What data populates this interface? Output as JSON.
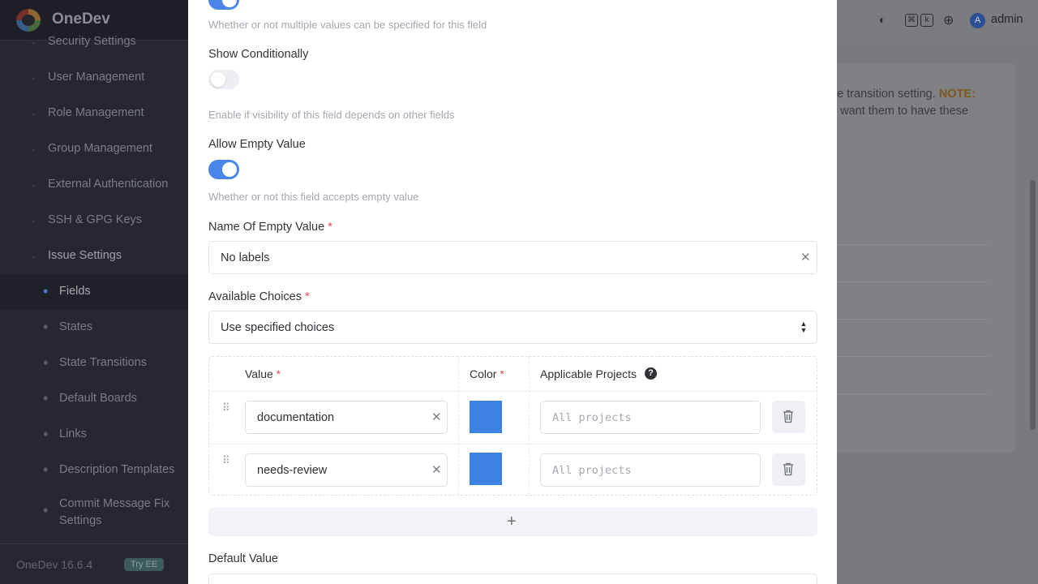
{
  "brand": {
    "name": "OneDev",
    "version": "OneDev 16.6.4",
    "try_ee": "Try EE"
  },
  "sidebar": {
    "items": [
      {
        "label": "Security Settings",
        "level": "top"
      },
      {
        "label": "User Management",
        "level": "top"
      },
      {
        "label": "Role Management",
        "level": "top"
      },
      {
        "label": "Group Management",
        "level": "top"
      },
      {
        "label": "External Authentication",
        "level": "top"
      },
      {
        "label": "SSH & GPG Keys",
        "level": "top"
      },
      {
        "label": "Issue Settings",
        "level": "top"
      },
      {
        "label": "Fields",
        "level": "sub",
        "active": true
      },
      {
        "label": "States",
        "level": "sub"
      },
      {
        "label": "State Transitions",
        "level": "sub"
      },
      {
        "label": "Default Boards",
        "level": "sub"
      },
      {
        "label": "Links",
        "level": "sub"
      },
      {
        "label": "Description Templates",
        "level": "sub"
      },
      {
        "label": "Commit Message Fix Settings",
        "level": "sub"
      }
    ]
  },
  "topbar": {
    "kbd_cmd": "⌘",
    "kbd_k": "k",
    "avatar_letter": "A",
    "user": "admin"
  },
  "background": {
    "note_prefix": "ue transition setting. ",
    "note_bold": "NOTE:",
    "note_rest": "u want them to have these"
  },
  "form": {
    "multiple_help": "Whether or not multiple values can be specified for this field",
    "multiple_on": true,
    "show_conditionally_label": "Show Conditionally",
    "show_conditionally_on": false,
    "show_conditionally_help": "Enable if visibility of this field depends on other fields",
    "allow_empty_label": "Allow Empty Value",
    "allow_empty_on": true,
    "allow_empty_help": "Whether or not this field accepts empty value",
    "empty_name_label": "Name Of Empty Value",
    "empty_name_value": "No labels",
    "available_choices_label": "Available Choices",
    "available_choices_value": "Use specified choices",
    "required_mark": "*",
    "default_value_label": "Default Value"
  },
  "choices": {
    "headers": {
      "value": "Value",
      "color": "Color",
      "projects": "Applicable Projects"
    },
    "rows": [
      {
        "value": "documentation",
        "color": "#3f82e6",
        "projects_placeholder": "All projects"
      },
      {
        "value": "needs-review",
        "color": "#3f82e6",
        "projects_placeholder": "All projects"
      }
    ],
    "add_label": "+"
  },
  "icons": {
    "theme": "contrast-icon",
    "language": "globe-icon",
    "clear": "close-icon",
    "select": "updown-icon",
    "drag": "grip-icon",
    "delete": "trash-icon",
    "help": "question-icon"
  }
}
